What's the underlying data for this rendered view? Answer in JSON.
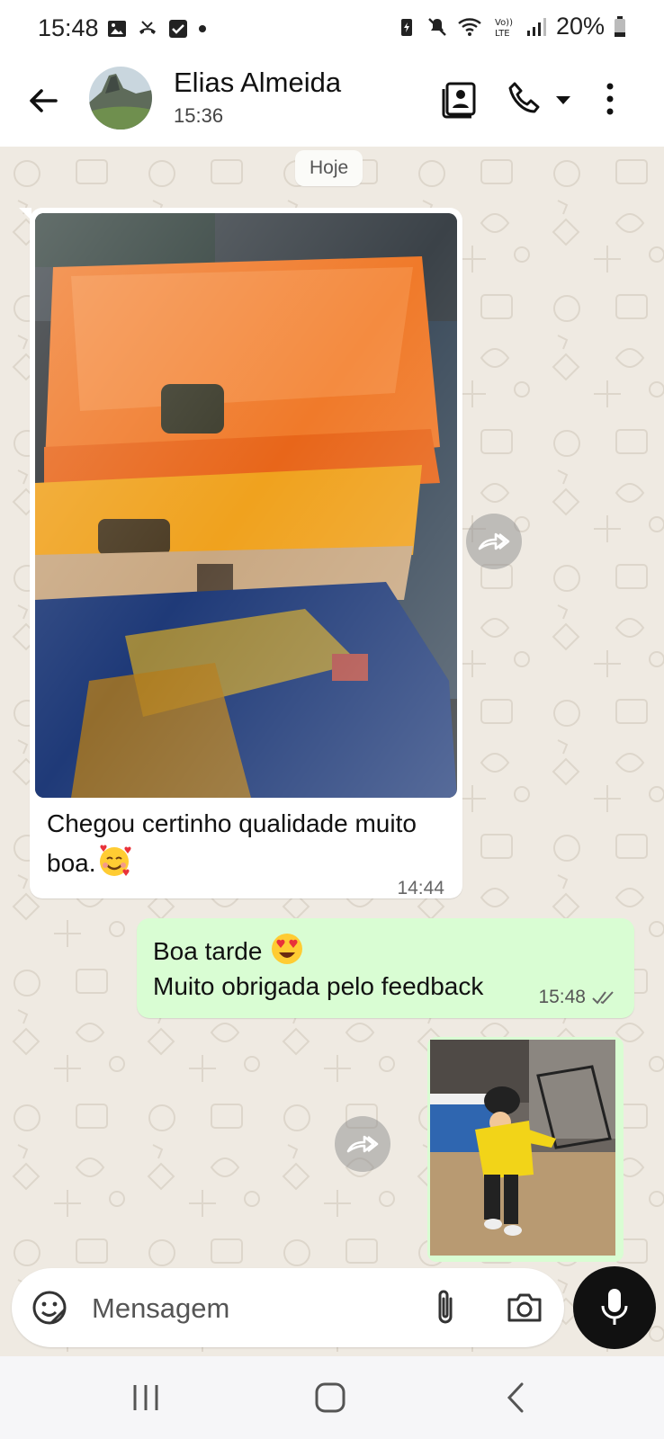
{
  "status_bar": {
    "time": "15:48",
    "battery": "20%",
    "left_icons": [
      "gallery-icon",
      "missed-call-icon",
      "checkbox-icon",
      "dot-icon"
    ],
    "right_icons": [
      "battery-saver-icon",
      "mute-icon",
      "wifi-icon",
      "volte-icon",
      "signal-icon",
      "battery-icon"
    ]
  },
  "header": {
    "contact_name": "Elias Almeida",
    "last_seen": "15:36",
    "actions": [
      "contact-card-icon",
      "phone-icon",
      "dropdown-icon",
      "more-icon"
    ]
  },
  "chat": {
    "date_chip": "Hoje",
    "messages": [
      {
        "direction": "incoming",
        "type": "image",
        "caption": "Chegou certinho qualidade muito boa.",
        "caption_emoji": "smiling-face-with-hearts",
        "time": "14:44"
      },
      {
        "direction": "outgoing",
        "type": "text",
        "line1": "Boa tarde",
        "line1_emoji": "heart-eyes",
        "line2": "Muito obrigada pelo feedback",
        "time": "15:48",
        "status": "delivered"
      },
      {
        "direction": "outgoing",
        "type": "image"
      }
    ]
  },
  "composer": {
    "placeholder": "Mensagem"
  },
  "colors": {
    "chat_background": "#efeae2",
    "incoming_bubble": "#ffffff",
    "outgoing_bubble": "#d9fdd3",
    "mic_button": "#111111"
  }
}
